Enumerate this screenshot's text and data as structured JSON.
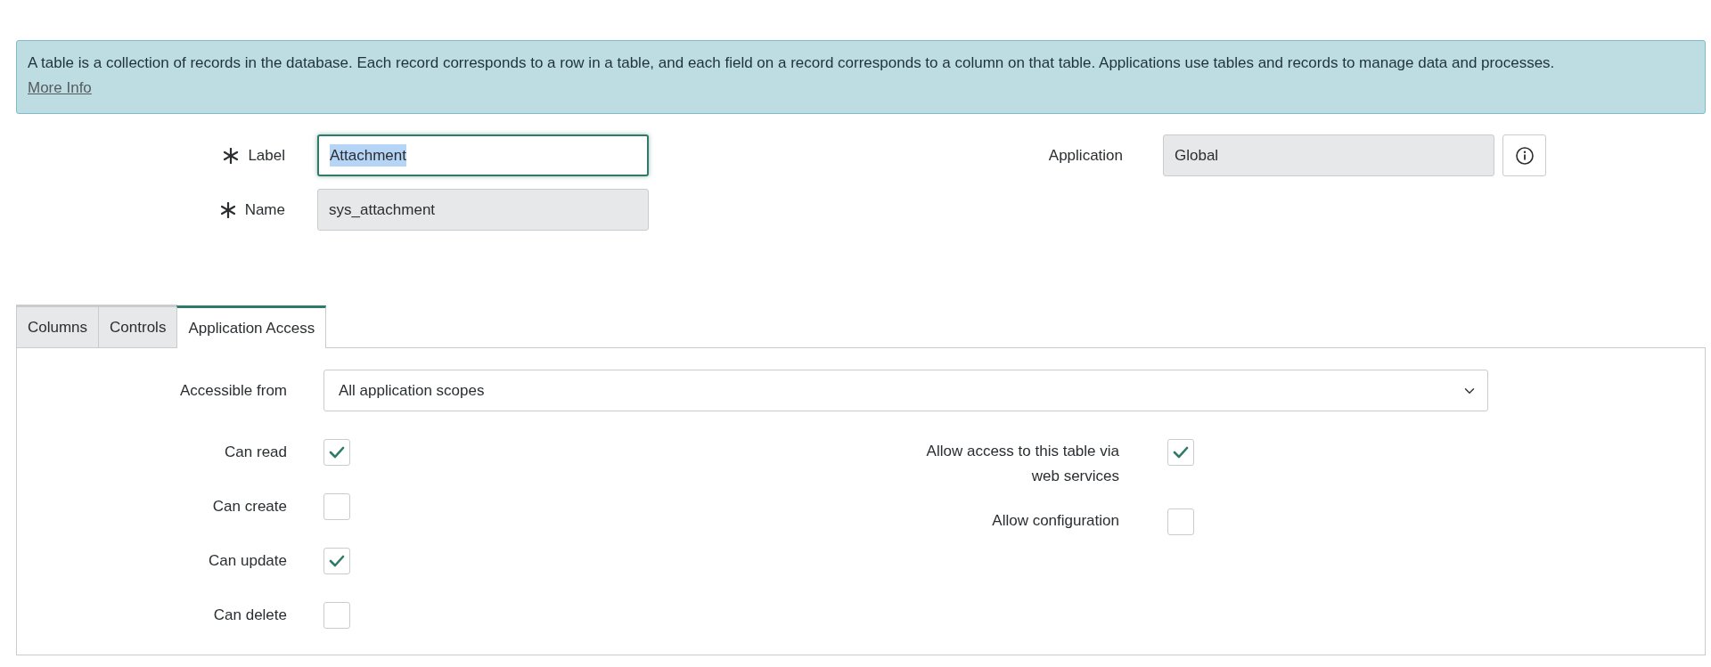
{
  "info_banner": {
    "text": "A table is a collection of records in the database. Each record corresponds to a row in a table, and each field on a record corresponds to a column on that table. Applications use tables and records to manage data and processes.",
    "link": "More Info"
  },
  "fields": [
    {
      "label": "Label",
      "mandatory": true,
      "value": "Attachment",
      "readonly": false,
      "focused": true,
      "text_selected": true
    },
    {
      "label": "Name",
      "mandatory": true,
      "value": "sys_attachment",
      "readonly": true,
      "focused": false,
      "text_selected": false
    }
  ],
  "application": {
    "label": "Application",
    "value": "Global",
    "readonly": true
  },
  "tabs": [
    {
      "label": "Columns",
      "selected": false
    },
    {
      "label": "Controls",
      "selected": false
    },
    {
      "label": "Application Access",
      "selected": true
    }
  ],
  "accessible_from": {
    "label": "Accessible from",
    "value": "All application scopes"
  },
  "left_checkboxes": [
    {
      "label": "Can read",
      "checked": true
    },
    {
      "label": "Can create",
      "checked": false
    },
    {
      "label": "Can update",
      "checked": true
    },
    {
      "label": "Can delete",
      "checked": false
    }
  ],
  "right_checkboxes": [
    {
      "label": "Allow access to this table via web services",
      "checked": true
    },
    {
      "label": "Allow configuration",
      "checked": false
    }
  ]
}
